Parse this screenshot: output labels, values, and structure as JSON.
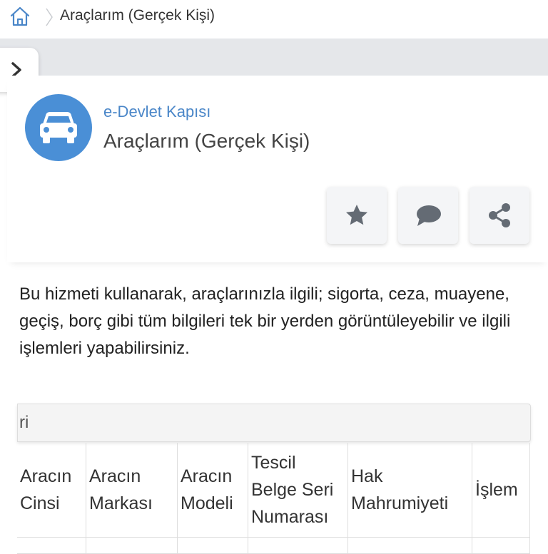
{
  "breadcrumb": {
    "current": "Araçlarım (Gerçek Kişi)"
  },
  "service": {
    "portal": "e-Devlet Kapısı",
    "title": "Araçlarım (Gerçek Kişi)",
    "icon": "car-icon",
    "accent_color": "#4a8fd6"
  },
  "actions": [
    {
      "name": "favorite",
      "icon": "star-icon"
    },
    {
      "name": "feedback",
      "icon": "comment-icon"
    },
    {
      "name": "share",
      "icon": "share-icon"
    }
  ],
  "description": "Bu hizmeti kullanarak, araçlarınızla ilgili; sigorta, ceza, muayene, geçiş, borç gibi tüm bilgileri tek bir yerden görüntüleyebilir ve ilgili işlemleri yapabilirsiniz.",
  "table": {
    "caption_fragment": "ri",
    "columns": [
      "Aracın Cinsi",
      "Aracın Markası",
      "Aracın Modeli",
      "Tescil Belge Seri Numarası",
      "Hak Mahrumiyeti",
      "İşlem"
    ]
  }
}
